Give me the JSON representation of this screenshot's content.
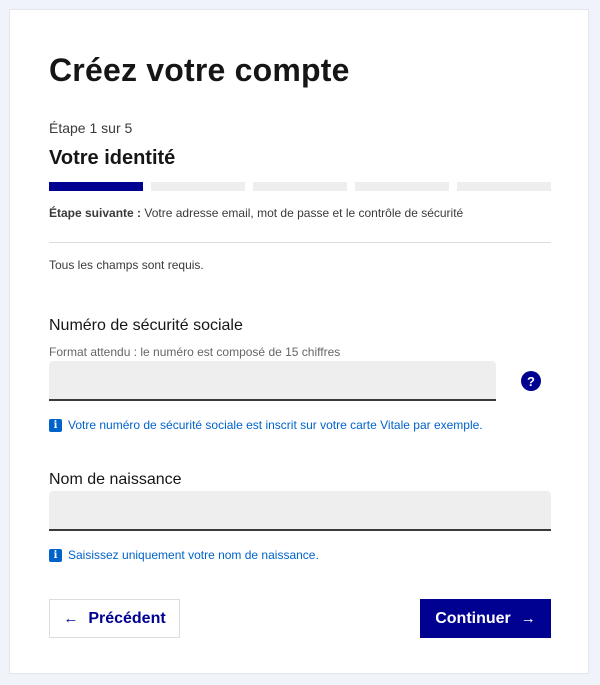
{
  "page": {
    "title": "Créez votre compte"
  },
  "stepper": {
    "step_count": "Étape 1 sur 5",
    "step_title": "Votre identité",
    "total_steps": 5,
    "current_step": 1,
    "next_label": "Étape suivante :",
    "next_text": "Votre adresse email, mot de passe et le contrôle de sécurité"
  },
  "form": {
    "required_note": "Tous les champs sont requis.",
    "ssn": {
      "label": "Numéro de sécurité sociale",
      "hint": "Format attendu : le numéro est composé de 15 chiffres",
      "value": "",
      "help_icon": "question-circle-icon",
      "help_glyph": "?",
      "info": "Votre numéro de sécurité sociale est inscrit sur votre carte Vitale par exemple."
    },
    "birth_name": {
      "label": "Nom de naissance",
      "value": "",
      "info": "Saisissez uniquement votre nom de naissance."
    },
    "info_icon": "info-icon",
    "info_glyph": "i"
  },
  "actions": {
    "previous_label": "Précédent",
    "previous_icon": "arrow-left-icon",
    "continue_label": "Continuer",
    "continue_icon": "arrow-right-icon"
  },
  "colors": {
    "primary": "#000091",
    "info": "#0063cb",
    "background": "#f1f3fb",
    "input_bg": "#eeeeee"
  }
}
